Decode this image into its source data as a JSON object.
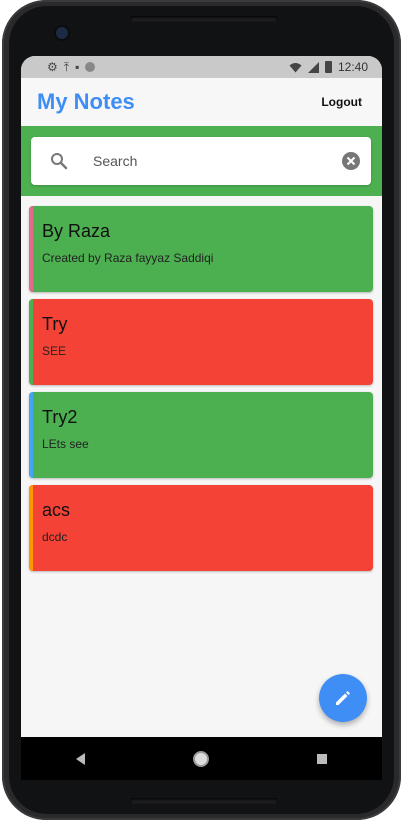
{
  "status_bar": {
    "time": "12:40",
    "left_icons": [
      "gear-icon",
      "upload-icon",
      "sd-card-icon",
      "circle-icon"
    ],
    "right_icons": [
      "wifi-icon",
      "signal-icon",
      "battery-icon"
    ]
  },
  "appbar": {
    "title": "My Notes",
    "logout_label": "Logout"
  },
  "search": {
    "placeholder": "Search",
    "value": ""
  },
  "notes": [
    {
      "title": "By Raza",
      "body": "Created by Raza fayyaz Saddiqi",
      "color": "#4caf50",
      "accent": "#e06b8b"
    },
    {
      "title": "Try",
      "body": "SEE",
      "color": "#f44336",
      "accent": "#4caf50"
    },
    {
      "title": "Try2",
      "body": "LEts see",
      "color": "#4caf50",
      "accent": "#42a5f5"
    },
    {
      "title": "acs",
      "body": "dcdc",
      "color": "#f44336",
      "accent": "#ff9800"
    }
  ],
  "colors": {
    "primary": "#3f8ef5",
    "search_band": "#4caf50",
    "background": "#f6f6f6"
  },
  "fab_icon": "pencil-icon",
  "nav_icons": [
    "back-icon",
    "home-icon",
    "recents-icon"
  ]
}
